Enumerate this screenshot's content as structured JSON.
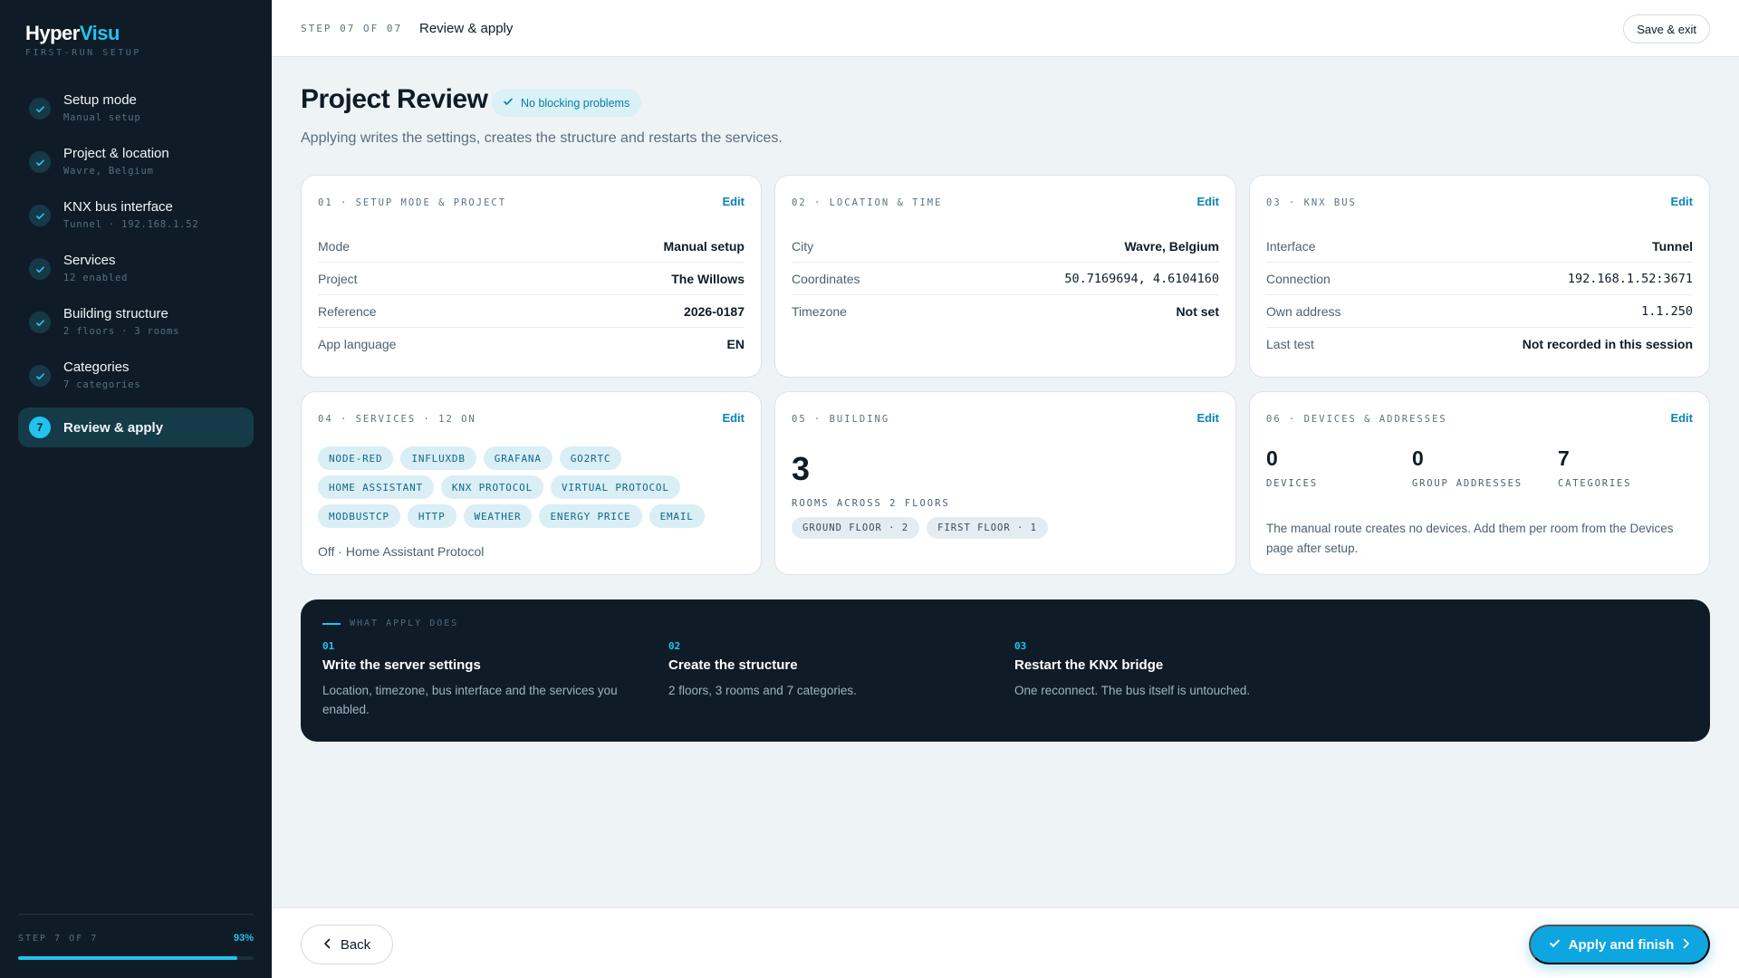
{
  "brand": {
    "name_a": "Hyper",
    "name_b": "Visu",
    "subtitle": "FIRST-RUN SETUP"
  },
  "sidebar": {
    "steps": [
      {
        "label": "Setup mode",
        "detail": "Manual setup",
        "state": "done"
      },
      {
        "label": "Project & location",
        "detail": "Wavre, Belgium",
        "state": "done"
      },
      {
        "label": "KNX bus interface",
        "detail": "Tunnel · 192.168.1.52",
        "state": "done"
      },
      {
        "label": "Services",
        "detail": "12 enabled",
        "state": "done"
      },
      {
        "label": "Building structure",
        "detail": "2 floors · 3 rooms",
        "state": "done"
      },
      {
        "label": "Categories",
        "detail": "7 categories",
        "state": "done"
      },
      {
        "label": "Review & apply",
        "number": "7",
        "state": "active"
      }
    ],
    "footer_label": "STEP 7 OF 7",
    "progress_text": "93%",
    "progress": 0.93
  },
  "topbar": {
    "step": "STEP 07 OF 07",
    "separator": "·",
    "title": "Review & apply",
    "save_exit": "Save & exit"
  },
  "header": {
    "title": "Project Review",
    "badge": "No blocking problems",
    "subtitle": "Applying writes the settings, creates the structure and restarts the services."
  },
  "cards": {
    "setup": {
      "heading": "01 · SETUP MODE & PROJECT",
      "edit": "Edit",
      "rows": [
        {
          "k": "Mode",
          "v": "Manual setup"
        },
        {
          "k": "Project",
          "v": "The Willows"
        },
        {
          "k": "Reference",
          "v": "2026-0187"
        },
        {
          "k": "App language",
          "v": "EN"
        }
      ]
    },
    "location": {
      "heading": "02 · LOCATION & TIME",
      "edit": "Edit",
      "rows": [
        {
          "k": "City",
          "v": "Wavre, Belgium"
        },
        {
          "k": "Coordinates",
          "v": "50.7169694, 4.6104160"
        },
        {
          "k": "Timezone",
          "v": "Not set"
        }
      ]
    },
    "knx": {
      "heading": "03 · KNX BUS",
      "edit": "Edit",
      "rows": [
        {
          "k": "Interface",
          "v": "Tunnel"
        },
        {
          "k": "Connection",
          "v": "192.168.1.52:3671"
        },
        {
          "k": "Own address",
          "v": "1.1.250"
        },
        {
          "k": "Last test",
          "v": "Not recorded in this session"
        }
      ]
    },
    "services": {
      "heading": "04 · SERVICES · 12 ON",
      "edit": "Edit",
      "chips": [
        "NODE-RED",
        "INFLUXDB",
        "GRAFANA",
        "GO2RTC",
        "HOME ASSISTANT",
        "KNX PROTOCOL",
        "VIRTUAL PROTOCOL",
        "MODBUSTCP",
        "HTTP",
        "WEATHER",
        "ENERGY PRICE",
        "EMAIL"
      ],
      "off_note": "Off · Home Assistant Protocol"
    },
    "building": {
      "heading": "05 · BUILDING",
      "edit": "Edit",
      "rooms": "3",
      "rooms_label": "ROOMS ACROSS 2 FLOORS",
      "floors": [
        "GROUND FLOOR · 2",
        "FIRST FLOOR · 1"
      ]
    },
    "devices": {
      "heading": "06 · DEVICES & ADDRESSES",
      "edit": "Edit",
      "stats": [
        {
          "n": "0",
          "l": "DEVICES"
        },
        {
          "n": "0",
          "l": "GROUP ADDRESSES"
        },
        {
          "n": "7",
          "l": "CATEGORIES"
        }
      ],
      "note": "The manual route creates no devices. Add them per room from the Devices page after setup."
    }
  },
  "apply_panel": {
    "eyebrow": "WHAT APPLY DOES",
    "items": [
      {
        "num": "01",
        "title": "Write the server settings",
        "desc": "Location, timezone, bus interface and the services you enabled."
      },
      {
        "num": "02",
        "title": "Create the structure",
        "desc": "2 floors, 3 rooms and 7 categories."
      },
      {
        "num": "03",
        "title": "Restart the KNX bridge",
        "desc": "One reconnect. The bus itself is untouched."
      }
    ]
  },
  "footer": {
    "back": "Back",
    "apply": "Apply and finish"
  },
  "colors": {
    "accent": "#22c3ee",
    "primary_button": "#0ea6e0",
    "sidebar_bg": "#0f1c28",
    "link": "#0a84b5"
  }
}
